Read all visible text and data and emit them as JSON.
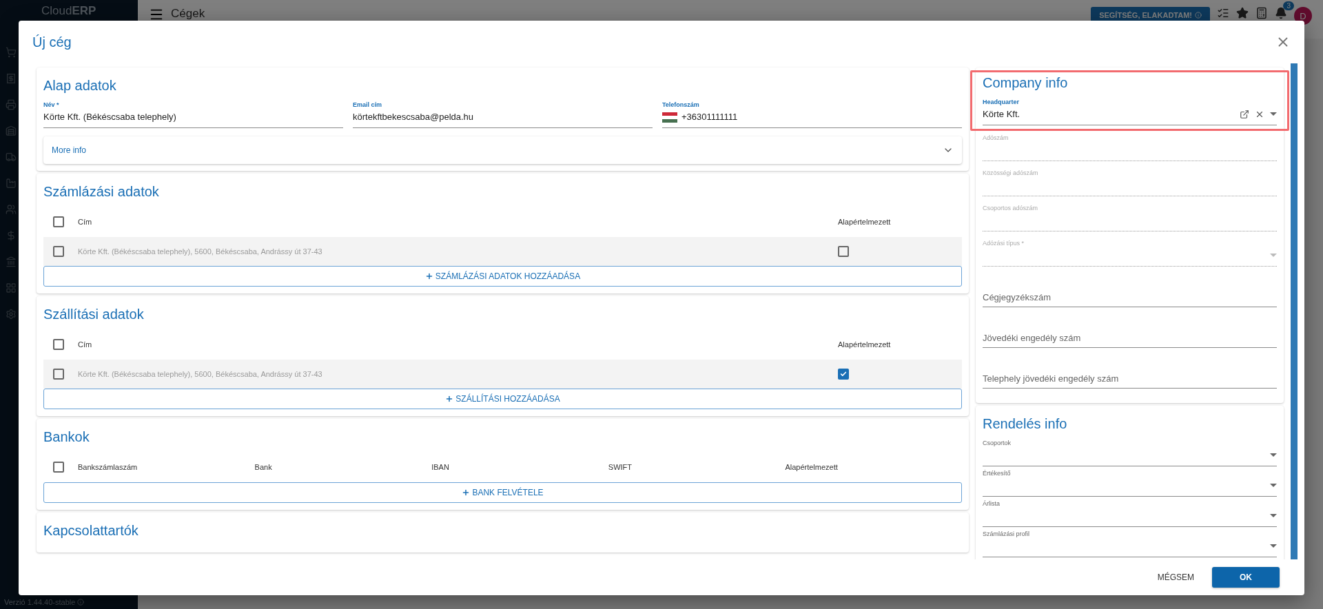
{
  "app": {
    "logo": "Cloud**ERP**",
    "page_title": "Cégek",
    "help_button": "SEGÍTSÉG, ELAKADTAM!",
    "notification_count": "3",
    "avatar": "D",
    "version": "Verzió 1.44.40-stable"
  },
  "modal": {
    "title": "Új cég",
    "basic": {
      "title": "Alap adatok",
      "fields": [
        {
          "label": "Név *",
          "value": "Körte Kft. (Békéscsaba telephely)",
          "kind": "text"
        },
        {
          "label": "Email cím",
          "value": "körtekftbekescsaba@pelda.hu",
          "kind": "text"
        },
        {
          "label": "Telefonszám",
          "value": "+36301111111",
          "kind": "phone"
        }
      ],
      "more_info": {
        "label": "More info",
        "expanded": false
      }
    },
    "tables": [
      {
        "title": "Számlázási adatok",
        "columns": [
          "Cím",
          "Alapértelmezett"
        ],
        "header_checked": false,
        "rows": [
          {
            "cells": [
              "Körte Kft. (Békéscsaba telephely), 5600, Békéscsaba, Andrássy út 37-43"
            ],
            "checked": false,
            "default": false
          }
        ],
        "add_button": "SZÁMLÁZÁSI ADATOK HOZZÁADÁSA"
      },
      {
        "title": "Szállítási adatok",
        "columns": [
          "Cím",
          "Alapértelmezett"
        ],
        "header_checked": false,
        "rows": [
          {
            "cells": [
              "Körte Kft. (Békéscsaba telephely), 5600, Békéscsaba, Andrássy út 37-43"
            ],
            "checked": false,
            "default": true
          }
        ],
        "add_button": "SZÁLLÍTÁSI HOZZÁADÁSA"
      },
      {
        "title": "Bankok",
        "columns": [
          "Bankszámlaszám",
          "Bank",
          "IBAN",
          "SWIFT",
          "Alapértelmezett"
        ],
        "header_checked": false,
        "add_button": "BANK FELVÉTELE"
      },
      {
        "title": "Kapcsolattartók"
      }
    ],
    "company_info": {
      "title": "Company info",
      "highlighted": true,
      "fields": [
        {
          "label": "Headquarter",
          "value": "Körte Kft.",
          "kind": "autocomplete"
        },
        {
          "label": "Adószám",
          "kind": "disabled"
        },
        {
          "label": "Közösségi adószám",
          "kind": "disabled"
        },
        {
          "label": "Csoportos adószám",
          "kind": "disabled"
        },
        {
          "label": "Adózási típus *",
          "kind": "disabled-select"
        },
        {
          "label": "Cégjegyzékszám",
          "kind": "empty"
        },
        {
          "label": "Jövedéki engedély szám",
          "kind": "empty"
        },
        {
          "label": "Telephely jövedéki engedély szám",
          "kind": "empty"
        }
      ]
    },
    "order_info": {
      "title": "Rendelés info",
      "fields": [
        {
          "label": "Csoportok",
          "kind": "select"
        },
        {
          "label": "Értékesítő",
          "kind": "select"
        },
        {
          "label": "Árlista",
          "kind": "select"
        },
        {
          "label": "Számlázási profil",
          "kind": "select"
        }
      ]
    },
    "buttons": [
      {
        "label": "MÉGSEM",
        "kind": "text"
      },
      {
        "label": "OK",
        "kind": "primary"
      }
    ]
  }
}
